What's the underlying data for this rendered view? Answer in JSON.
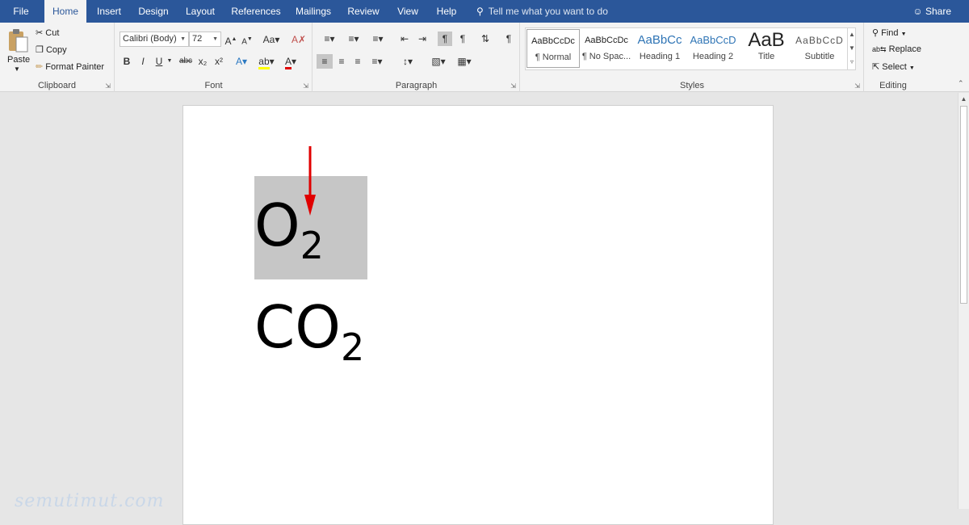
{
  "tabs": [
    "File",
    "Home",
    "Insert",
    "Design",
    "Layout",
    "References",
    "Mailings",
    "Review",
    "View",
    "Help"
  ],
  "active_tab": "Home",
  "tellme": "Tell me what you want to do",
  "share": "Share",
  "clipboard": {
    "paste": "Paste",
    "cut": "Cut",
    "copy": "Copy",
    "format_painter": "Format Painter",
    "label": "Clipboard"
  },
  "font": {
    "family": "Calibri (Body)",
    "size": "72",
    "label": "Font",
    "bold": "B",
    "italic": "I",
    "underline": "U",
    "strike": "abc",
    "sub": "x₂",
    "sup": "x²"
  },
  "paragraph": {
    "label": "Paragraph"
  },
  "styles": {
    "label": "Styles",
    "items": [
      {
        "preview": "AaBbCcDc",
        "name": "¶ Normal"
      },
      {
        "preview": "AaBbCcDc",
        "name": "¶ No Spac..."
      },
      {
        "preview": "AaBbCc",
        "name": "Heading 1"
      },
      {
        "preview": "AaBbCcD",
        "name": "Heading 2"
      },
      {
        "preview": "AaB",
        "name": "Title"
      },
      {
        "preview": "AaBbCcD",
        "name": "Subtitle"
      }
    ]
  },
  "editing": {
    "find": "Find",
    "replace": "Replace",
    "select": "Select",
    "label": "Editing"
  },
  "document": {
    "line1_main": "O",
    "line1_sub": "2",
    "line2_main": "CO",
    "line2_sub": "2"
  },
  "watermark": "semutimut.com",
  "colors": {
    "brand": "#2b579a",
    "arrow": "#e00000",
    "selection": "#c6c6c6"
  }
}
